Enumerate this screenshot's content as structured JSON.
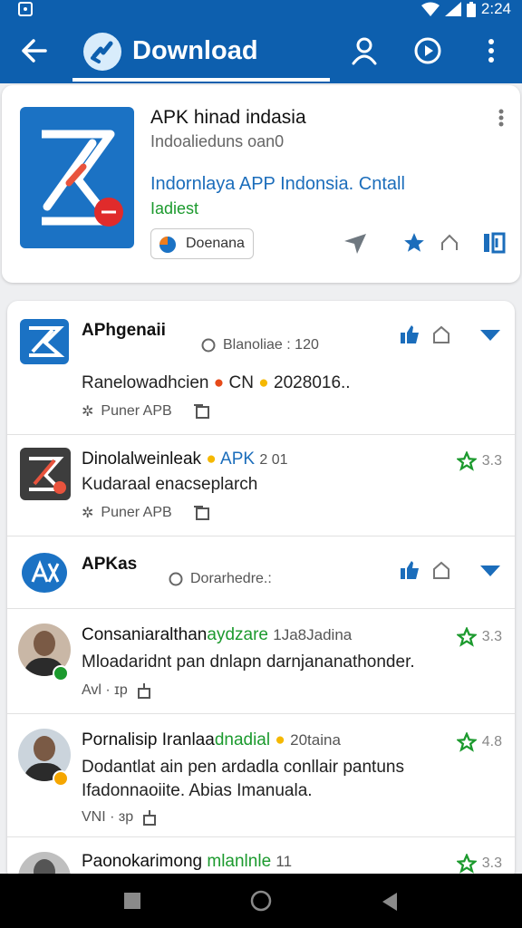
{
  "status": {
    "time": "2:24"
  },
  "appbar": {
    "title": "Download"
  },
  "hero": {
    "name": "APK hinad indasia",
    "sub": "Indoalieduns oan0",
    "desc": "Indornlaya APP Indonsia. Cntall",
    "desc2": "Iadiest",
    "button_label": "Doenana"
  },
  "list": [
    {
      "title": "APhgenaii",
      "meta_right": "Blanoliae : 120",
      "line2": "Ranelowadhcien",
      "line2_mid": "CN",
      "line2_end": "2028016..",
      "meta": "Puner APB"
    },
    {
      "title": "Dinolalweinleak",
      "title_mid": "APK",
      "title_num": "2 01",
      "line2": "Kudaraal enacseplarch",
      "meta": "Puner APB",
      "rating": "3.3"
    },
    {
      "title": "APKas",
      "meta_right": "Dorarhedre.:"
    },
    {
      "title": "Consaniaralthan",
      "title_green": "aydzare",
      "title_end": "1Ja8Jadina",
      "line2": "Mloadaridnt pan dnlapn darnjananathonder.",
      "meta": "Avl · ɪp",
      "rating": "3.3"
    },
    {
      "title": "Pornalisip Iranlaa",
      "title_green": "dnadial",
      "title_end": "20taina",
      "line2": "Dodantlat ain pen ardadla conllair pantuns",
      "line3": "Ifadonnaoiite. Abias Imanuala.",
      "meta": "VNI · ɜp",
      "rating": "4.8"
    },
    {
      "title": "Paonokarimong",
      "title_green": "mlanlnle",
      "title_end": "11",
      "rating": "3.3"
    }
  ],
  "colors": {
    "primary": "#0d5fae",
    "accent_green": "#1c9a2e",
    "link_blue": "#1b6dbb"
  }
}
